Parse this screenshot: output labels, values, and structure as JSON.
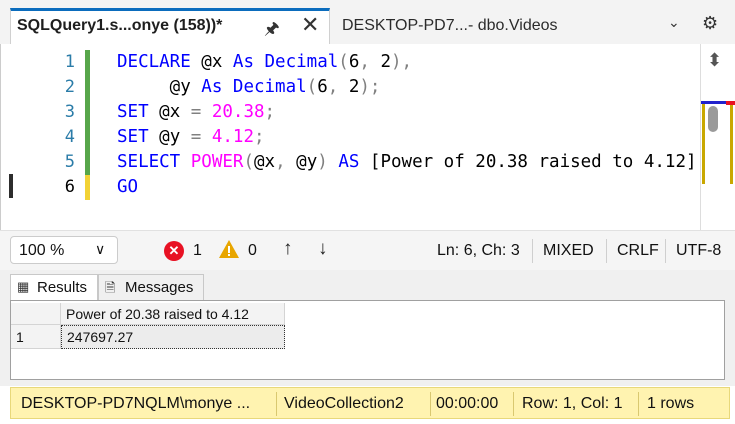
{
  "tabs": {
    "active_title": "SQLQuery1.s...onye (158))*",
    "inactive_title": "DESKTOP-PD7...- dbo.Videos"
  },
  "editor": {
    "line_numbers": [
      "1",
      "2",
      "3",
      "4",
      "5",
      "6"
    ],
    "lines": [
      [
        {
          "t": "DECLARE ",
          "c": "kw"
        },
        {
          "t": "@x ",
          "c": ""
        },
        {
          "t": "As ",
          "c": "kw"
        },
        {
          "t": "Decimal",
          "c": "kw"
        },
        {
          "t": "(",
          "c": "op"
        },
        {
          "t": "6",
          "c": ""
        },
        {
          "t": ", ",
          "c": "op"
        },
        {
          "t": "2",
          "c": ""
        },
        {
          "t": "),",
          "c": "op"
        }
      ],
      [
        {
          "t": "     @y ",
          "c": ""
        },
        {
          "t": "As ",
          "c": "kw"
        },
        {
          "t": "Decimal",
          "c": "kw"
        },
        {
          "t": "(",
          "c": "op"
        },
        {
          "t": "6",
          "c": ""
        },
        {
          "t": ", ",
          "c": "op"
        },
        {
          "t": "2",
          "c": ""
        },
        {
          "t": ");",
          "c": "op"
        }
      ],
      [
        {
          "t": "SET ",
          "c": "kw"
        },
        {
          "t": "@x ",
          "c": ""
        },
        {
          "t": "= ",
          "c": "op"
        },
        {
          "t": "20.38",
          "c": "fn"
        },
        {
          "t": ";",
          "c": "op"
        }
      ],
      [
        {
          "t": "SET ",
          "c": "kw"
        },
        {
          "t": "@y ",
          "c": ""
        },
        {
          "t": "= ",
          "c": "op"
        },
        {
          "t": "4.12",
          "c": "fn"
        },
        {
          "t": ";",
          "c": "op"
        }
      ],
      [
        {
          "t": "SELECT ",
          "c": "kw"
        },
        {
          "t": "POWER",
          "c": "fn"
        },
        {
          "t": "(",
          "c": "op"
        },
        {
          "t": "@x",
          "c": ""
        },
        {
          "t": ", ",
          "c": "op"
        },
        {
          "t": "@y",
          "c": ""
        },
        {
          "t": ") ",
          "c": "op"
        },
        {
          "t": "AS ",
          "c": "kw"
        },
        {
          "t": "[Power of 20.38 raised to 4.12]",
          "c": ""
        }
      ],
      [
        {
          "t": "GO",
          "c": "kw"
        }
      ]
    ]
  },
  "editbar": {
    "zoom": "100 %",
    "errors": "1",
    "warnings": "0",
    "position": "Ln: 6, Ch: 3",
    "mode": "MIXED",
    "line_ending": "CRLF",
    "encoding": "UTF-8"
  },
  "results": {
    "tab_results": "Results",
    "tab_messages": "Messages",
    "column_header": "Power of 20.38 raised to 4.12",
    "rows": [
      {
        "num": "1",
        "value": "247697.27"
      }
    ]
  },
  "statusbar": {
    "server": "DESKTOP-PD7NQLM\\monye ...",
    "database": "VideoCollection2",
    "elapsed": "00:00:00",
    "rowcol": "Row: 1, Col: 1",
    "rows": "1 rows"
  },
  "colors": {
    "keyword": "#0000ff",
    "function": "#ff00ff",
    "statusbar": "#fff3b0",
    "tab_accent": "#0b6cbd"
  }
}
